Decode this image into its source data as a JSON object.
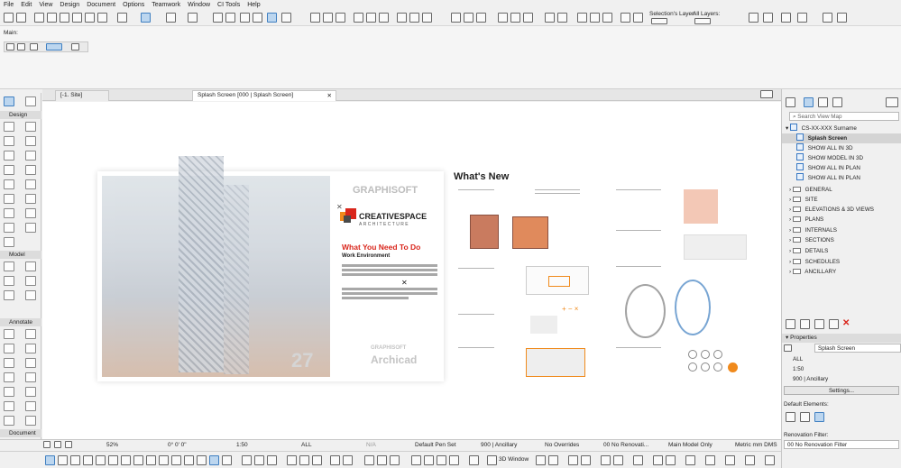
{
  "menu": [
    "File",
    "Edit",
    "View",
    "Design",
    "Document",
    "Options",
    "Teamwork",
    "Window",
    "CI Tools",
    "Help"
  ],
  "toolbar": {
    "selections_layer_label": "Selection's Layer:",
    "all_layers_label": "All Layers:"
  },
  "infobox": {
    "main_label": "Main:"
  },
  "tabs": [
    {
      "label": "[-1. Site]"
    },
    {
      "label": "Splash Screen [000 | Splash Screen]"
    }
  ],
  "toolbox": {
    "sections": [
      "Design",
      "Model",
      "Annotate",
      "Document"
    ]
  },
  "splash": {
    "graphisoft_logo": "GRAPHISOFT",
    "brand_name": "CREATIVESPACE",
    "brand_sub": "ARCHITECTURE",
    "headline": "What You Need To Do",
    "subhead": "Work Environment",
    "version": "27",
    "archicad_top": "GRAPHISOFT",
    "archicad": "Archicad"
  },
  "whats_new": {
    "title": "What's New"
  },
  "statusbar": {
    "zoom": "52%",
    "angle": "0° 0' 0\"",
    "scale": "1:50",
    "layer_combo": "ALL",
    "na": "N/A",
    "pen_set": "Default Pen Set",
    "model_view": "900 | Ancillary",
    "overrides": "No Overrides",
    "renovation": "00 No Renovati...",
    "model_only": "Main Model Only",
    "units": "Metric mm DMS",
    "window_3d": "3D Window"
  },
  "navigator": {
    "search_placeholder": "Search View Map",
    "root": "CS-XX-XXX Surname",
    "items": [
      {
        "label": "Splash Screen",
        "type": "view",
        "selected": true
      },
      {
        "label": "SHOW ALL IN 3D",
        "type": "view"
      },
      {
        "label": "SHOW MODEL IN 3D",
        "type": "view"
      },
      {
        "label": "SHOW ALL IN PLAN",
        "type": "view"
      },
      {
        "label": "SHOW ALL IN PLAN",
        "type": "view"
      },
      {
        "label": "GENERAL",
        "type": "folder"
      },
      {
        "label": "SITE",
        "type": "folder"
      },
      {
        "label": "ELEVATIONS & 3D VIEWS",
        "type": "folder"
      },
      {
        "label": "PLANS",
        "type": "folder"
      },
      {
        "label": "INTERNALS",
        "type": "folder"
      },
      {
        "label": "SECTIONS",
        "type": "folder"
      },
      {
        "label": "DETAILS",
        "type": "folder"
      },
      {
        "label": "SCHEDULES",
        "type": "folder"
      },
      {
        "label": "ANCILLARY",
        "type": "folder"
      }
    ]
  },
  "properties": {
    "header": "Properties",
    "name_value": "Splash Screen",
    "layer_combo": "ALL",
    "scale": "1:50",
    "model_view": "900 | Ancillary",
    "settings_button": "Settings...",
    "default_elements_label": "Default Elements:",
    "renovation_filter_label": "Renovation Filter:",
    "renovation_filter_value": "00 No Renovation Filter"
  },
  "colors": {
    "accent_blue": "#3f7fc1",
    "brand_red": "#d9261c",
    "brand_orange": "#f08a1c",
    "delete_red": "#d9261c"
  }
}
